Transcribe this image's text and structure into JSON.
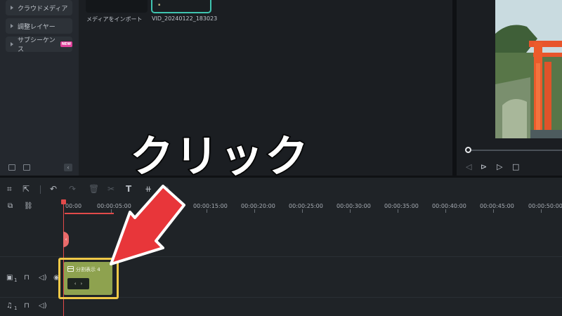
{
  "sidebar": {
    "items": [
      {
        "label": "クラウドメディア"
      },
      {
        "label": "調整レイヤー"
      },
      {
        "label": "サブシーケンス",
        "badge": "NEW"
      }
    ],
    "collapse_glyph": "‹"
  },
  "media": {
    "items": [
      {
        "label": "メディアをインポート"
      },
      {
        "label": "VID_20240122_183023"
      }
    ]
  },
  "annotation": {
    "callout_text": "クリック",
    "highlight_color": "#f0c948",
    "arrow_color": "#e8363a"
  },
  "toolbar": {
    "icons": [
      "grid-icon",
      "select-tool-icon",
      "undo-icon",
      "redo-icon",
      "delete-icon",
      "cut-icon",
      "text-icon",
      "adjust-icon",
      "replace-icon"
    ]
  },
  "ruler": {
    "ticks": [
      "00:00",
      "00:00:05:00",
      "00:00:15:00",
      "00:00:20:00",
      "00:00:25:00",
      "00:00:30:00",
      "00:00:35:00",
      "00:00:40:00",
      "00:00:45:00",
      "00:00:50:00"
    ]
  },
  "tracks": {
    "video_index": "1",
    "audio_index": "1"
  },
  "clip": {
    "title": "分割表示 4",
    "chip_left": "‹",
    "chip_right": "›",
    "color": "#8ea24f"
  },
  "playhead": {
    "tab_glyph": "‹",
    "color": "#e24a4a"
  }
}
